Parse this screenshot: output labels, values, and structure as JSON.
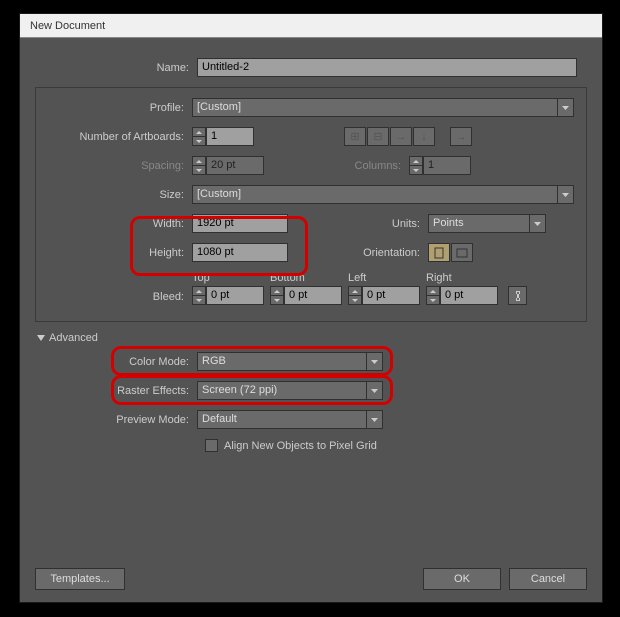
{
  "window": {
    "title": "New Document"
  },
  "name": {
    "label": "Name:",
    "value": "Untitled-2"
  },
  "profile": {
    "label": "Profile:",
    "value": "[Custom]"
  },
  "artboards": {
    "label": "Number of Artboards:",
    "value": "1",
    "spacing_label": "Spacing:",
    "spacing_value": "20 pt",
    "columns_label": "Columns:",
    "columns_value": "1"
  },
  "size": {
    "label": "Size:",
    "value": "[Custom]"
  },
  "width": {
    "label": "Width:",
    "value": "1920 pt"
  },
  "height": {
    "label": "Height:",
    "value": "1080 pt"
  },
  "units": {
    "label": "Units:",
    "value": "Points"
  },
  "orientation": {
    "label": "Orientation:"
  },
  "bleed": {
    "label": "Bleed:",
    "top": {
      "label": "Top",
      "value": "0 pt"
    },
    "bottom": {
      "label": "Bottom",
      "value": "0 pt"
    },
    "left": {
      "label": "Left",
      "value": "0 pt"
    },
    "right": {
      "label": "Right",
      "value": "0 pt"
    }
  },
  "advanced": {
    "label": "Advanced",
    "color_mode": {
      "label": "Color Mode:",
      "value": "RGB"
    },
    "raster": {
      "label": "Raster Effects:",
      "value": "Screen (72 ppi)"
    },
    "preview": {
      "label": "Preview Mode:",
      "value": "Default"
    },
    "align": "Align New Objects to Pixel Grid"
  },
  "footer": {
    "templates": "Templates...",
    "ok": "OK",
    "cancel": "Cancel"
  }
}
